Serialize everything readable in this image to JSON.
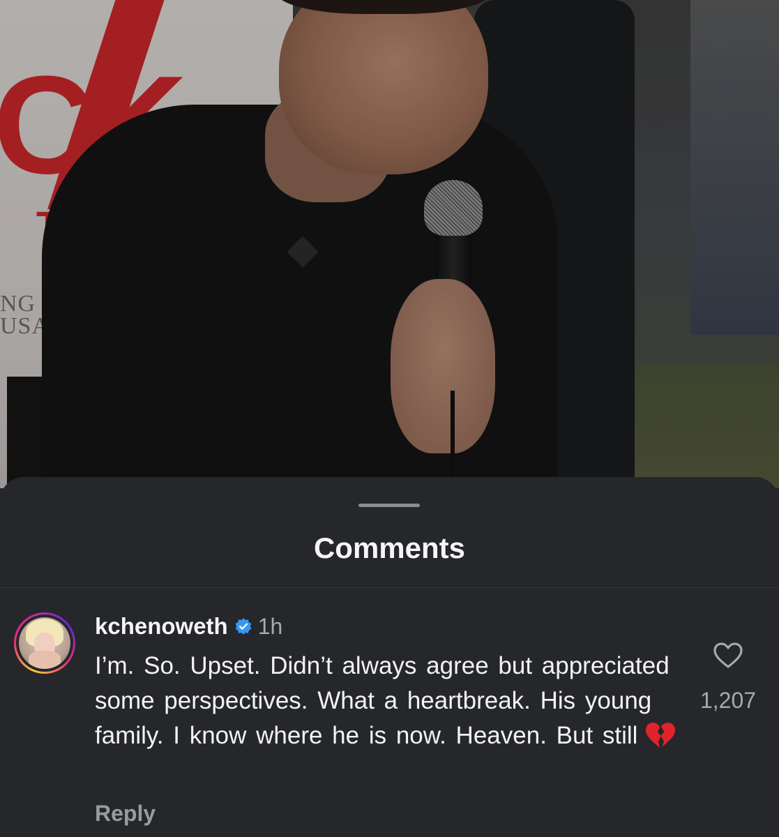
{
  "media": {
    "banner_big_text": "CK",
    "banner_small_text": "TO",
    "banner_serif_text": "NG\nUSA"
  },
  "sheet": {
    "title": "Comments"
  },
  "comment": {
    "username": "kchenoweth",
    "verified": true,
    "timestamp": "1h",
    "text": "I’m.  So.  Upset.  Didn’t always agree but appreciated some perspectives.  What a heartbreak.  His young family.  I know where he is now.  Heaven.  But still",
    "trailing_emoji": "broken-heart-icon",
    "like_count": "1,207",
    "reply_label": "Reply"
  },
  "colors": {
    "sheet_background": "#25272b",
    "verified_blue": "#3897f0",
    "broken_heart_red": "#e0242b"
  }
}
